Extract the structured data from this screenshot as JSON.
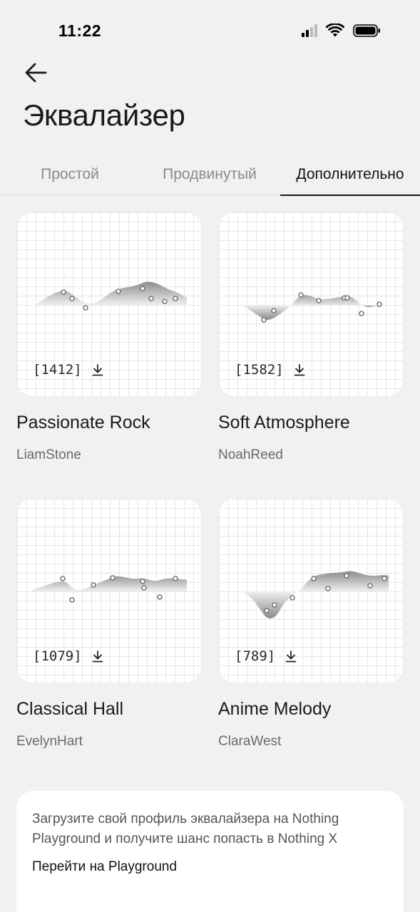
{
  "status_bar": {
    "time": "11:22"
  },
  "header": {
    "title": "Эквалайзер"
  },
  "tabs": [
    {
      "label": "Простой",
      "active": false
    },
    {
      "label": "Продвинутый",
      "active": false
    },
    {
      "label": "Дополнительно",
      "active": true
    }
  ],
  "cards": [
    {
      "title": "Passionate Rock",
      "author": "LiamStone",
      "downloads": "[1412]",
      "icon": "download-icon"
    },
    {
      "title": "Soft Atmosphere",
      "author": "NoahReed",
      "downloads": "[1582]",
      "icon": "download-icon"
    },
    {
      "title": "Classical Hall",
      "author": "EvelynHart",
      "downloads": "[1079]",
      "icon": "download-icon"
    },
    {
      "title": "Anime Melody",
      "author": "ClaraWest",
      "downloads": "[789]",
      "icon": "download-icon"
    }
  ],
  "info": {
    "text": "Загрузите свой профиль эквалайзера на Nothing Playground и получите шанс попасть в Nothing X",
    "link": "Перейти на Playground"
  },
  "colors": {
    "background": "#f1f1f1",
    "card": "#ffffff",
    "accent": "#141414",
    "muted": "#8a8a8a"
  }
}
